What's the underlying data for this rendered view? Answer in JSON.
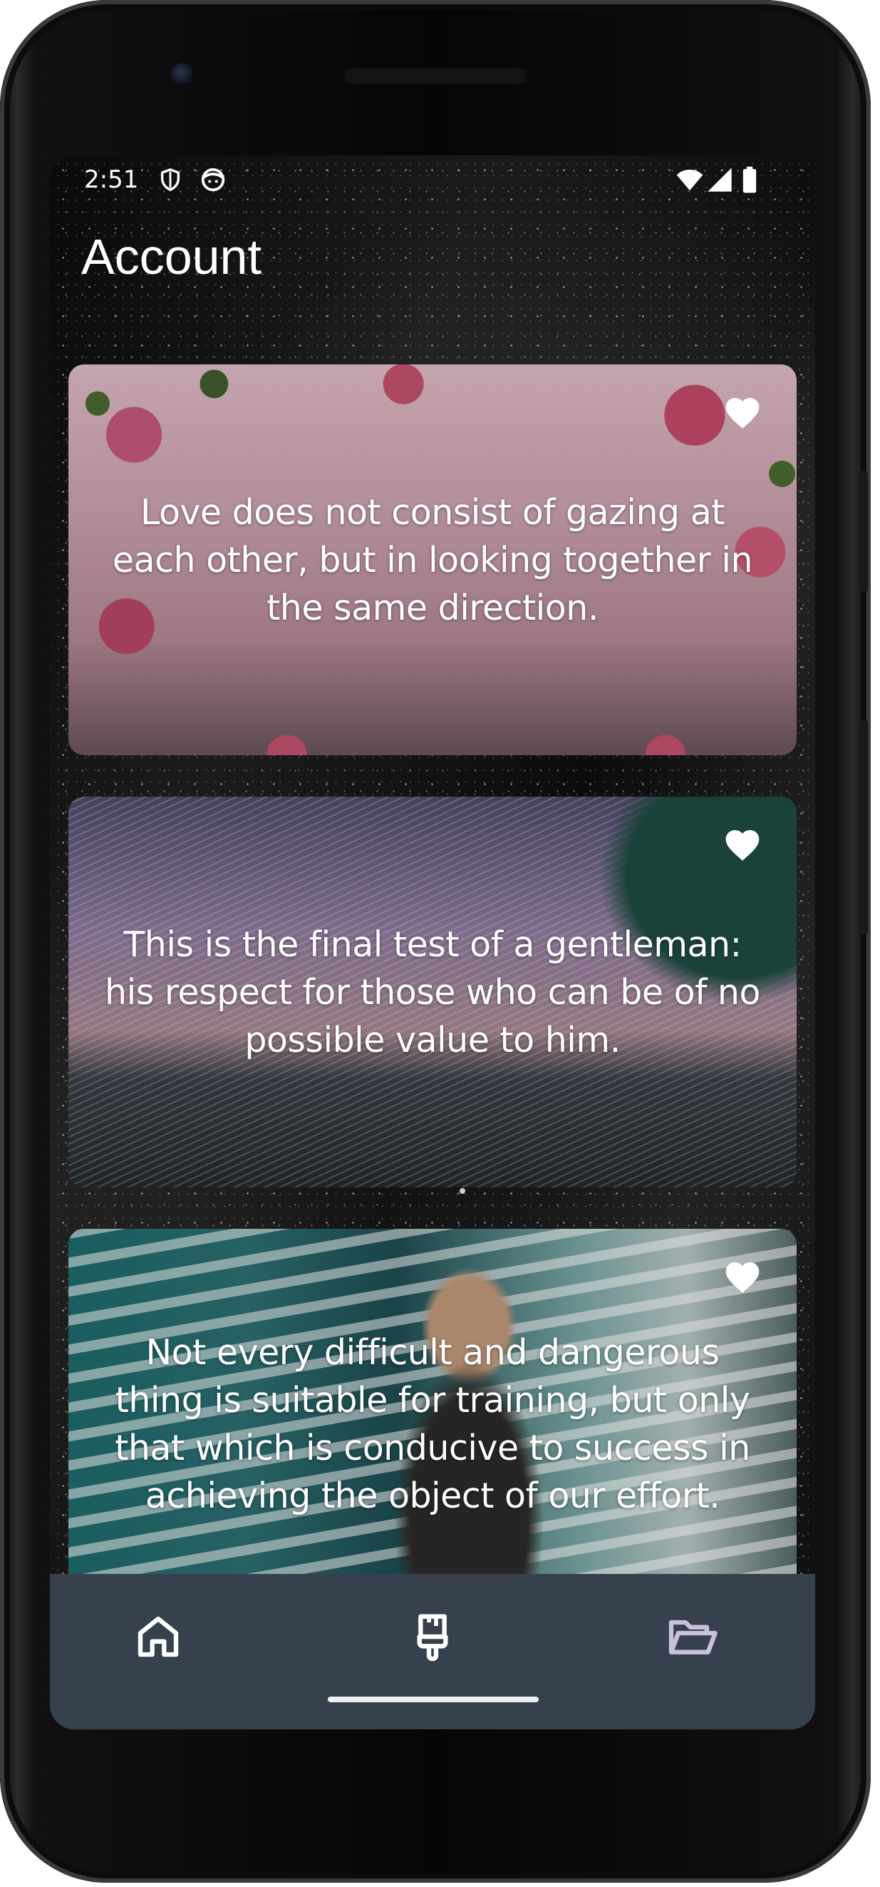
{
  "status_bar": {
    "time": "2:51",
    "icons": [
      "shield-icon",
      "face-icon",
      "wifi-icon",
      "cell-signal-icon",
      "battery-icon"
    ]
  },
  "page": {
    "title": "Account"
  },
  "quotes": [
    {
      "text": "Love does not consist of gazing at each other, but in looking together in the same direction.",
      "favorite": true,
      "background": "pink roses"
    },
    {
      "text": "This is the final test of a gentleman: his respect for those who can be of no possible value to him.",
      "favorite": true,
      "background": "star trails over lake"
    },
    {
      "text": "Not every difficult and dangerous thing is suitable for training, but only that which is conducive to success in achieving the object of our effort.",
      "favorite": true,
      "background": "woman in teal city"
    }
  ],
  "bottom_nav": {
    "items": [
      {
        "icon": "home-icon",
        "selected": false
      },
      {
        "icon": "brush-icon",
        "selected": true
      },
      {
        "icon": "folder-open-icon",
        "selected": false
      }
    ]
  },
  "colors": {
    "nav_background": "#36414d",
    "nav_icon": "#ffffff",
    "nav_icon_inactive": "#c9c2de",
    "heart": "#ffffff"
  }
}
